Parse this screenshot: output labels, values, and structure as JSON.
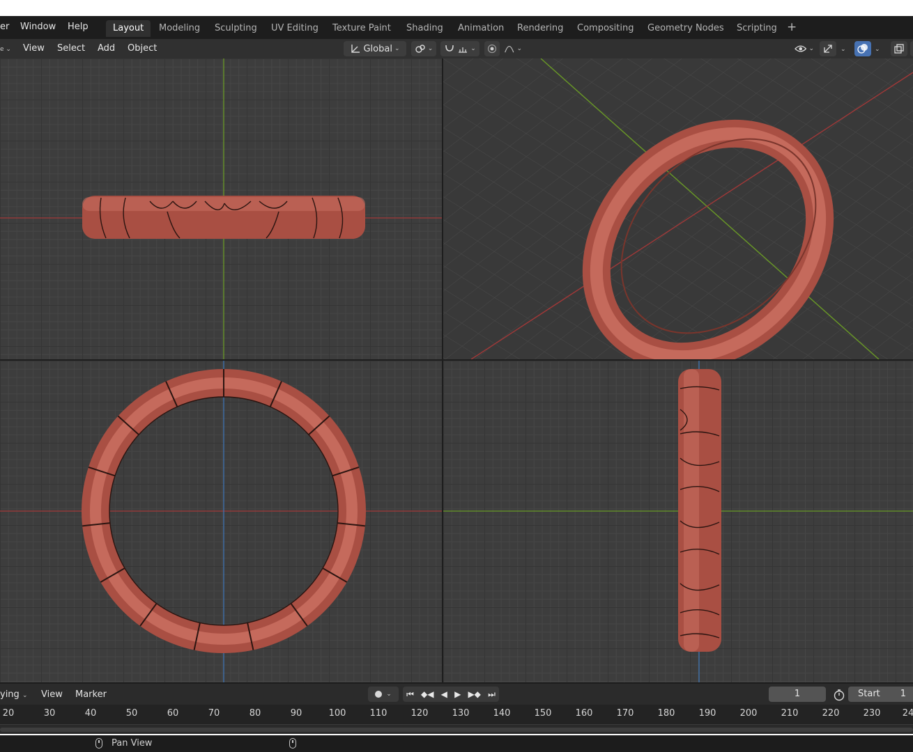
{
  "menu": {
    "items": [
      {
        "label": "er"
      },
      {
        "label": "Window"
      },
      {
        "label": "Help"
      }
    ]
  },
  "workspaces": {
    "tabs": [
      {
        "label": "Layout",
        "active": true
      },
      {
        "label": "Modeling"
      },
      {
        "label": "Sculpting"
      },
      {
        "label": "UV Editing"
      },
      {
        "label": "Texture Paint"
      },
      {
        "label": "Shading"
      },
      {
        "label": "Animation"
      },
      {
        "label": "Rendering"
      },
      {
        "label": "Compositing"
      },
      {
        "label": "Geometry Nodes"
      },
      {
        "label": "Scripting"
      }
    ],
    "add_icon": "plus-icon"
  },
  "header3d": {
    "menus": [
      {
        "label": "View"
      },
      {
        "label": "Select"
      },
      {
        "label": "Add"
      },
      {
        "label": "Object"
      }
    ],
    "orientation": "Global",
    "icons": [
      "transform-orientation-icon",
      "pivot-icon",
      "snap-icon",
      "proportional-edit-icon",
      "falloff-icon",
      "visibility-icon",
      "gizmo-icon",
      "overlay-icon",
      "xray-icon"
    ]
  },
  "viewports": {
    "object_color": "#b8574a",
    "axis_x_color": "#b03a3a",
    "axis_y_color": "#6d9a2a",
    "axis_z_color": "#3f74b3"
  },
  "timeline": {
    "playback_label": "ying",
    "menus": [
      {
        "label": "View"
      },
      {
        "label": "Marker"
      }
    ],
    "current_frame": "1",
    "start_label": "Start",
    "start_value": "1",
    "ruler_ticks": [
      "20",
      "30",
      "40",
      "50",
      "60",
      "70",
      "80",
      "90",
      "100",
      "110",
      "120",
      "130",
      "140",
      "150",
      "160",
      "170",
      "180",
      "190",
      "200",
      "210",
      "220",
      "230",
      "24"
    ]
  },
  "status": {
    "hint": "Pan View"
  }
}
